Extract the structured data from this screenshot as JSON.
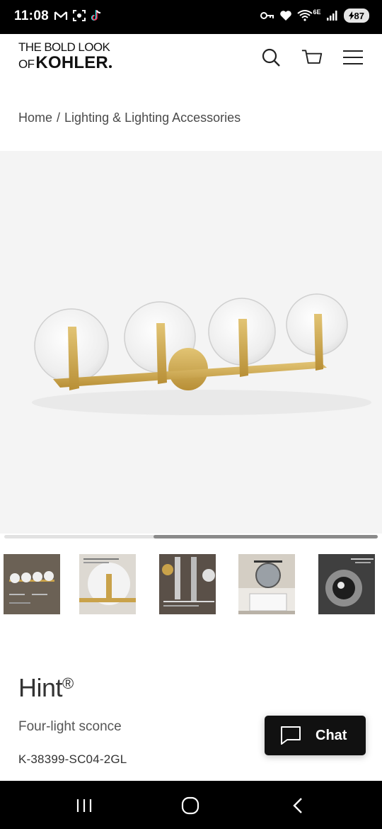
{
  "status_bar": {
    "time": "11:08",
    "left_icons": [
      "gmail-icon",
      "screenshot-icon",
      "tiktok-icon"
    ],
    "right_icons": [
      "vpn-key-icon",
      "heart-icon",
      "wifi-icon",
      "signal-icon"
    ],
    "network_label": "6E",
    "battery": "87"
  },
  "header": {
    "logo_line1": "THE BOLD LOOK",
    "logo_of": "OF",
    "logo_brand": "KOHLER",
    "icons": [
      "search-icon",
      "cart-icon",
      "menu-icon"
    ]
  },
  "breadcrumb": {
    "home": "Home",
    "separator": "/",
    "category": "Lighting & Lighting Accessories"
  },
  "gallery": {
    "progress_start": 0.4,
    "progress_end": 1.0,
    "thumbnail_count": 5
  },
  "product": {
    "name": "Hint",
    "trademark": "®",
    "subtitle": "Four-light sconce",
    "sku": "K-38399-SC04-2GL"
  },
  "chat": {
    "label": "Chat"
  },
  "nav_bar": {
    "icons": [
      "recent-apps-icon",
      "home-icon",
      "back-icon"
    ]
  },
  "colors": {
    "accent_gold": "#c9a24a",
    "dark": "#111111"
  }
}
